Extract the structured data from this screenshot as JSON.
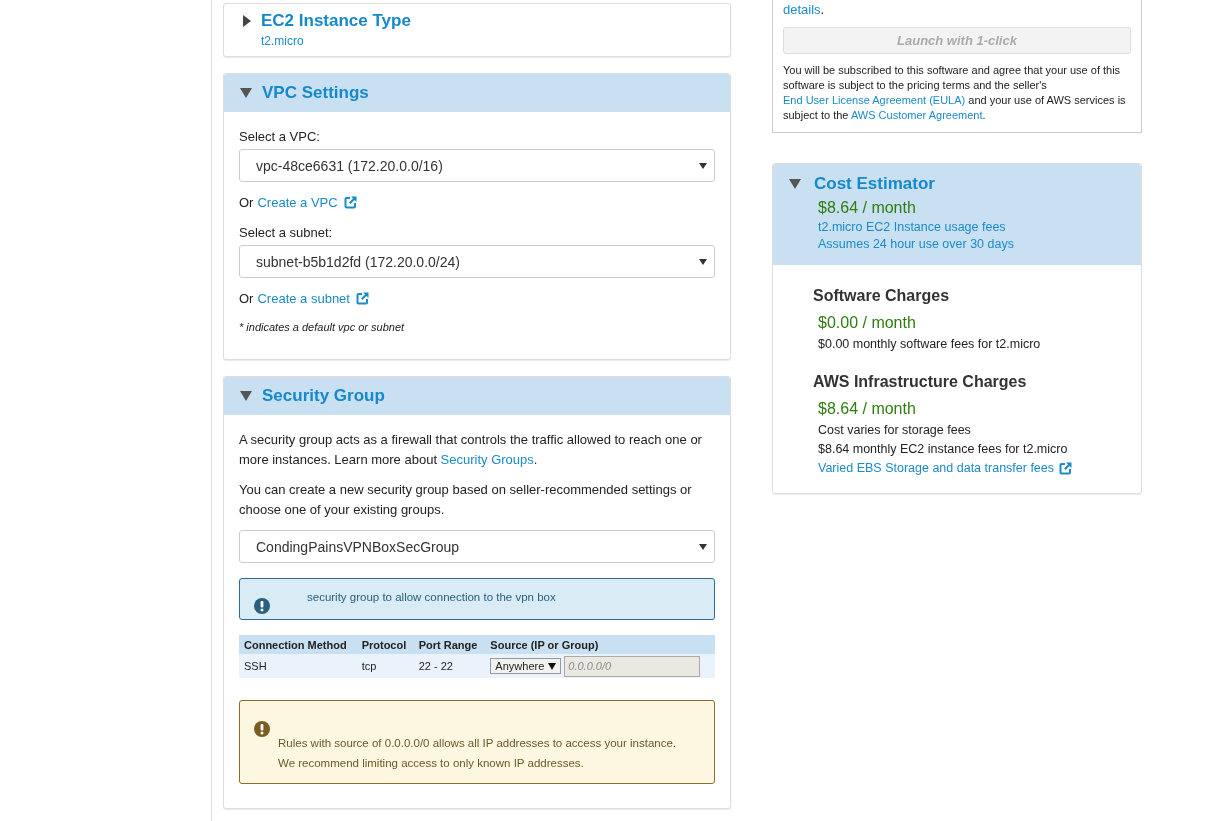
{
  "instance_type": {
    "title": "EC2 Instance Type",
    "value": "t2.micro",
    "expanded": false
  },
  "vpc": {
    "title": "VPC Settings",
    "expanded": true,
    "vpc_label": "Select a VPC:",
    "vpc_value": "vpc-48ce6631 (172.20.0.0/16)",
    "vpc_or": "Or",
    "vpc_link": "Create a VPC",
    "subnet_label": "Select a subnet:",
    "subnet_value": "subnet-b5b1d2fd (172.20.0.0/24)",
    "subnet_or": "Or",
    "subnet_link": "Create a subnet",
    "note": "* indicates a default vpc or subnet"
  },
  "security_group": {
    "title": "Security Group",
    "expanded": true,
    "intro": "A security group acts as a firewall that controls the traffic allowed to reach one or more instances. Learn more about ",
    "intro_link": "Security Groups",
    "intro_end": ".",
    "description": "You can create a new security group based on seller-recommended settings or choose one of your existing groups.",
    "group_value": "CondingPainsVPNBoxSecGroup",
    "info": "security group to allow connection to the vpn box",
    "table": {
      "columns": [
        "Connection Method",
        "Protocol",
        "Port Range",
        "Source (IP or Group)"
      ],
      "rows": [
        {
          "method": "SSH",
          "protocol": "tcp",
          "port_range": "22 - 22",
          "source": "Anywhere",
          "ip_placeholder": "0.0.0.0/0",
          "ip_disabled": true
        }
      ]
    },
    "warning": [
      "Rules with source of 0.0.0.0/0 allows all IP addresses to access your instance.",
      "We recommend limiting access to only known IP addresses."
    ]
  },
  "launch": {
    "details_link": "details",
    "details_end": ".",
    "button": "Launch with 1-click",
    "button_disabled": true,
    "terms": [
      {
        "text": "You will be subscribed to this software and agree that your use of this software is subject to the pricing terms and the seller's ",
        "link": false
      },
      {
        "text": "End User License Agreement (EULA)",
        "link": true
      },
      {
        "text": " and your use of AWS services is subject to the ",
        "link": false
      },
      {
        "text": "AWS Customer Agreement",
        "link": true
      },
      {
        "text": ".",
        "link": false
      }
    ]
  },
  "cost": {
    "title": "Cost Estimator",
    "expanded": true,
    "price": "$8.64 / month",
    "lines": [
      "t2.micro EC2 Instance usage fees",
      "Assumes 24 hour use over 30 days"
    ],
    "sections": [
      {
        "title": "Software Charges",
        "price": "$0.00 / month",
        "lines": [
          {
            "text": "$0.00 monthly software fees for t2.micro",
            "link": false
          }
        ]
      },
      {
        "title": "AWS Infrastructure Charges",
        "price": "$8.64 / month",
        "lines": [
          {
            "text": "Cost varies for storage fees",
            "link": false
          },
          {
            "text": "$8.64 monthly EC2 instance fees for t2.micro",
            "link": false
          },
          {
            "text": "Varied EBS Storage and data transfer fees",
            "link": true
          }
        ]
      }
    ]
  }
}
